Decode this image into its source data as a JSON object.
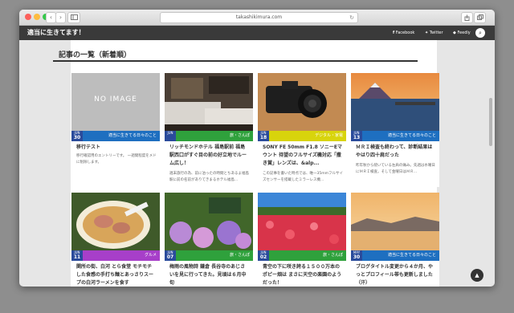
{
  "browser": {
    "url": "takashikimura.com",
    "reload_icon": "reload-icon",
    "back_icon": "chevron-left-icon",
    "forward_icon": "chevron-right-icon",
    "sidebar_icon": "sidebar-icon",
    "share_icon": "share-icon",
    "tabs_icon": "tabs-icon"
  },
  "site": {
    "title": "適当に生きてます！",
    "social": {
      "facebook": "Facebook",
      "twitter": "Twitter",
      "feedly": "Feedly"
    },
    "search_icon": "search-icon"
  },
  "section": {
    "title": "記事の一覧（新着順）"
  },
  "cards": [
    {
      "thumb_text": "NO IMAGE",
      "month": "JUN",
      "day": "30",
      "category": "適当に生きてる日々のこと",
      "cat_color": "#1e6fc0",
      "title": "移行テスト",
      "excerpt": "移行確認用のエントリーです。 一週間程度をメドに削除します。"
    },
    {
      "thumb_text": "",
      "month": "JUN",
      "day": "",
      "category": "旅・さんぽ",
      "cat_color": "#2fa13c",
      "title": "リッチモンドホテル 福島駅前 福島駅西口がすぐ目の前の好立地でルーム広し！",
      "excerpt": "週末旅行の為、前に泊ったの時間とちあるよ福島駅に前の名前がありてきまるホテル福島..."
    },
    {
      "thumb_text": "",
      "month": "JUN",
      "day": "18",
      "category": "デジタル・家電",
      "cat_color": "#d8d40c",
      "title": "SONY FE 50mm F1.8 ソニーEマウント 待望のフルサイズ機対応「撒き賞」レンズは、&alp...",
      "excerpt": "この記事を書いた時点では、唯一35mmフルサイズセンサーを搭載したミラーレス機..."
    },
    {
      "thumb_text": "",
      "month": "JUN",
      "day": "13",
      "category": "適当に生きてる日々のこと",
      "cat_color": "#1e6fc0",
      "title": "ＭＲＩ検査も終わって、診断結果はやはり四十肩だった",
      "excerpt": "昨年秋から続いている左肩の痛み。先週は水曜日にＭＲＩ検査。そして金曜日はＭＲ..."
    },
    {
      "thumb_text": "",
      "month": "JUN",
      "day": "11",
      "category": "グルメ",
      "cat_color": "#a73fc9",
      "title": "関所の街、白河 とら食堂 モチモチした食感の手打ち麺とあっさりスープの白河ラーメンを食す",
      "excerpt": ""
    },
    {
      "thumb_text": "",
      "month": "JUN",
      "day": "07",
      "category": "旅・さんぽ",
      "cat_color": "#2fa13c",
      "title": "梅雨の風物詩 鎌倉 長谷寺のあじさいを見に行ってきた。見頃は６月中旬",
      "excerpt": ""
    },
    {
      "thumb_text": "",
      "month": "JUN",
      "day": "02",
      "category": "旅・さんぽ",
      "cat_color": "#2fa13c",
      "title": "青空の下に咲き誇る１５００万本のポピー畑は まさに天空の楽園のようだった！",
      "excerpt": ""
    },
    {
      "thumb_text": "",
      "month": "MAY",
      "day": "30",
      "category": "適当に生きてる日々のこと",
      "cat_color": "#1e6fc0",
      "title": "ブログタイトル変更から４か月、やっとプロフィール帯も更新しました（汗）",
      "excerpt": ""
    }
  ],
  "ui": {
    "to_top_icon": "arrow-up-icon"
  }
}
